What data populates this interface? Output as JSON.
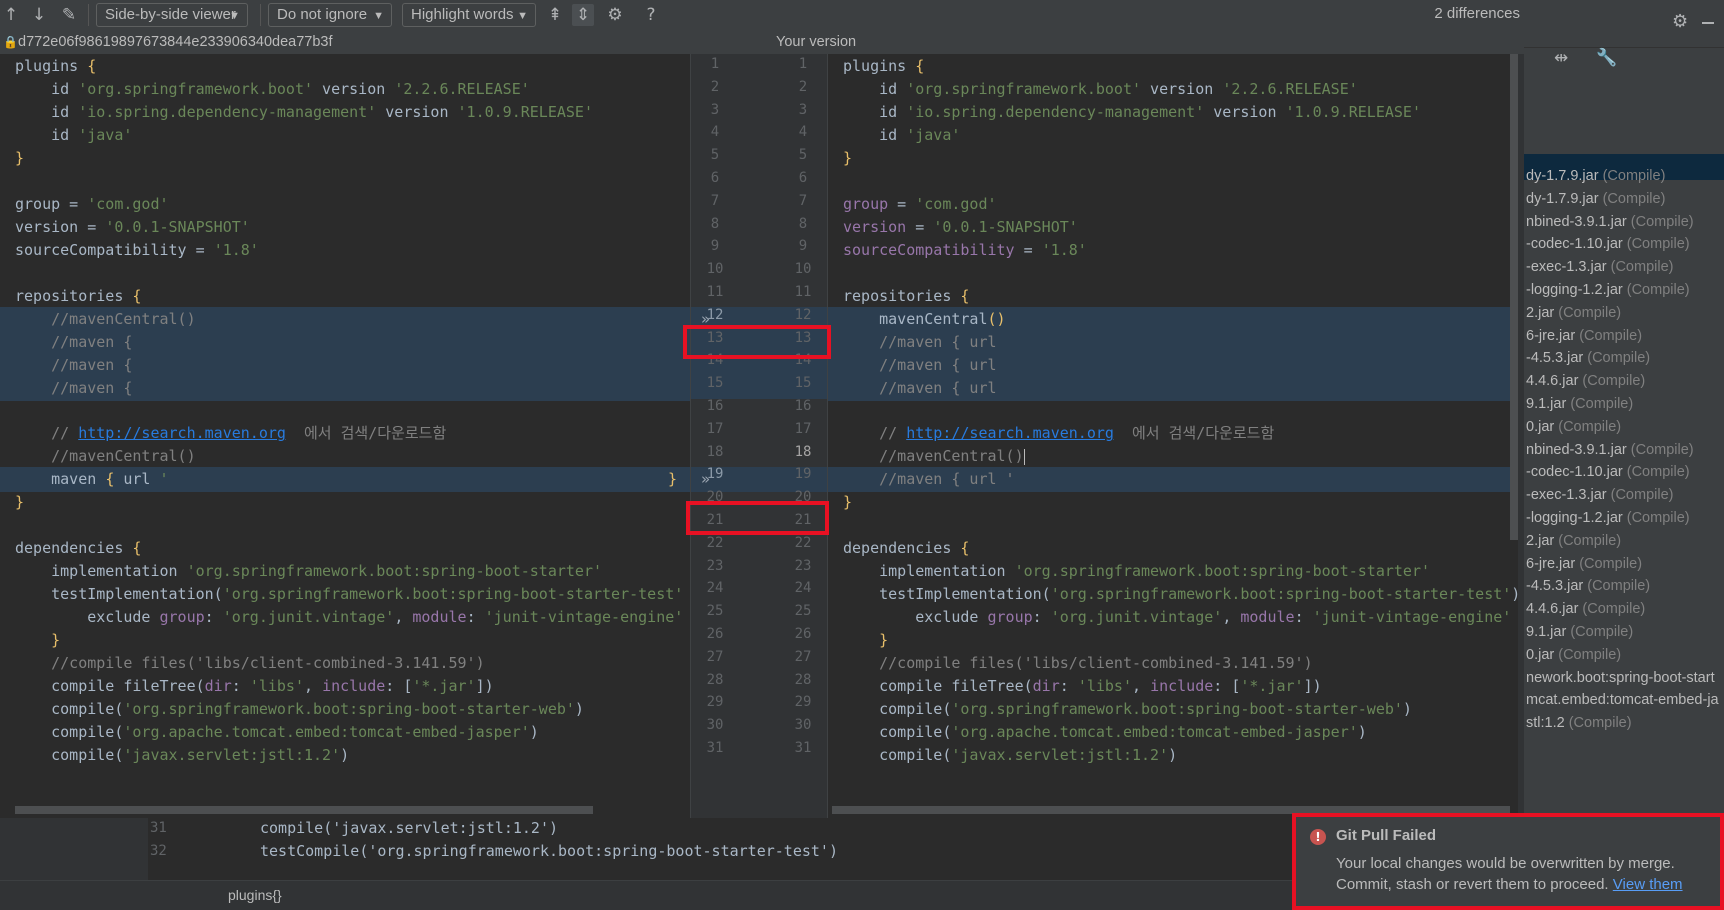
{
  "toolbar": {
    "viewer_label": "Side-by-side viewer",
    "ignore_label": "Do not ignore",
    "highlight_label": "Highlight words",
    "help_label": "?",
    "differences": "2 differences"
  },
  "titles": {
    "left": "d772e06f98619897673844e233906340dea77b3f",
    "right": "Your version"
  },
  "dependencies_panel": {
    "items": [
      {
        "name": "dy-1.7.9.jar",
        "scope": "(Compile)"
      },
      {
        "name": "dy-1.7.9.jar",
        "scope": "(Compile)"
      },
      {
        "name": "nbined-3.9.1.jar",
        "scope": "(Compile)"
      },
      {
        "name": "-codec-1.10.jar",
        "scope": "(Compile)"
      },
      {
        "name": "-exec-1.3.jar",
        "scope": "(Compile)"
      },
      {
        "name": "-logging-1.2.jar",
        "scope": "(Compile)"
      },
      {
        "name": "2.jar",
        "scope": "(Compile)"
      },
      {
        "name": "6-jre.jar",
        "scope": "(Compile)"
      },
      {
        "name": "-4.5.3.jar",
        "scope": "(Compile)"
      },
      {
        "name": "4.4.6.jar",
        "scope": "(Compile)"
      },
      {
        "name": "9.1.jar",
        "scope": "(Compile)"
      },
      {
        "name": "0.jar",
        "scope": "(Compile)"
      },
      {
        "name": "nbined-3.9.1.jar",
        "scope": "(Compile)"
      },
      {
        "name": "-codec-1.10.jar",
        "scope": "(Compile)"
      },
      {
        "name": "-exec-1.3.jar",
        "scope": "(Compile)"
      },
      {
        "name": "-logging-1.2.jar",
        "scope": "(Compile)"
      },
      {
        "name": "2.jar",
        "scope": "(Compile)"
      },
      {
        "name": "6-jre.jar",
        "scope": "(Compile)"
      },
      {
        "name": "-4.5.3.jar",
        "scope": "(Compile)"
      },
      {
        "name": "4.4.6.jar",
        "scope": "(Compile)"
      },
      {
        "name": "9.1.jar",
        "scope": "(Compile)"
      },
      {
        "name": "0.jar",
        "scope": "(Compile)"
      },
      {
        "name": "nework.boot:spring-boot-start",
        "scope": ""
      },
      {
        "name": "mcat.embed:tomcat-embed-ja",
        "scope": ""
      },
      {
        "name": "stl:1.2",
        "scope": "(Compile)"
      }
    ]
  },
  "bottom_editor": {
    "lines": [
      {
        "num": "31",
        "code": "compile('javax.servlet:jstl:1.2')"
      },
      {
        "num": "32",
        "code": "testCompile('org.springframework.boot:spring-boot-starter-test')"
      }
    ],
    "breadcrumb": "plugins{}"
  },
  "gutter": {
    "left_numbers": [
      "1",
      "2",
      "3",
      "4",
      "5",
      "6",
      "7",
      "8",
      "9",
      "10",
      "11",
      "12",
      "13",
      "14",
      "15",
      "16",
      "17",
      "18",
      "19",
      "20",
      "21",
      "22",
      "23",
      "24",
      "25",
      "26",
      "27",
      "28",
      "29",
      "30",
      "31"
    ],
    "right_numbers": [
      "1",
      "2",
      "3",
      "4",
      "5",
      "6",
      "7",
      "8",
      "9",
      "10",
      "11",
      "12",
      "13",
      "14",
      "15",
      "16",
      "17",
      "18",
      "19",
      "20",
      "21",
      "22",
      "23",
      "24",
      "25",
      "26",
      "27",
      "28",
      "29",
      "30",
      "31"
    ]
  },
  "notification": {
    "title": "Git Pull Failed",
    "message": "Your local changes would be overwritten by merge. Commit, stash or revert them to proceed.",
    "link": "View them"
  },
  "colors": {
    "error_red": "#e81123",
    "keyword": "#cc7832",
    "string": "#6a8759",
    "changed_bg": "#2c3e50"
  }
}
